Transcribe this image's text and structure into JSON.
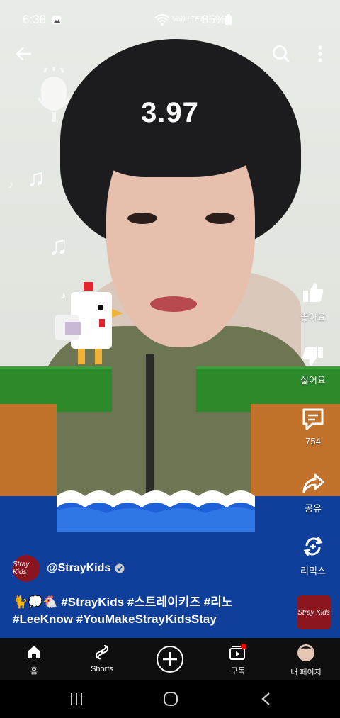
{
  "status_bar": {
    "time": "6:38",
    "network": "Vo)) LTE1",
    "battery": "85%"
  },
  "timer": "3.97",
  "rail": {
    "like_label": "좋아요",
    "dislike_label": "싫어요",
    "comments_count": "754",
    "share_label": "공유",
    "remix_label": "리믹스"
  },
  "channel": {
    "handle": "@StrayKids",
    "avatar_text": "Stray Kids"
  },
  "caption": {
    "line1": "🐈💭🐔 #StrayKids #스트레이키즈 #리노",
    "line2": "#LeeKnow #YouMakeStrayKidsStay"
  },
  "thumb_text": "Stray Kids",
  "nav": {
    "home": "홈",
    "shorts": "Shorts",
    "subs": "구독",
    "me": "내 페이지"
  },
  "colors": {
    "accent_red": "#ff0000",
    "water": "#0f3f9a",
    "grass": "#2d8a2b",
    "dirt": "#c3722c"
  }
}
